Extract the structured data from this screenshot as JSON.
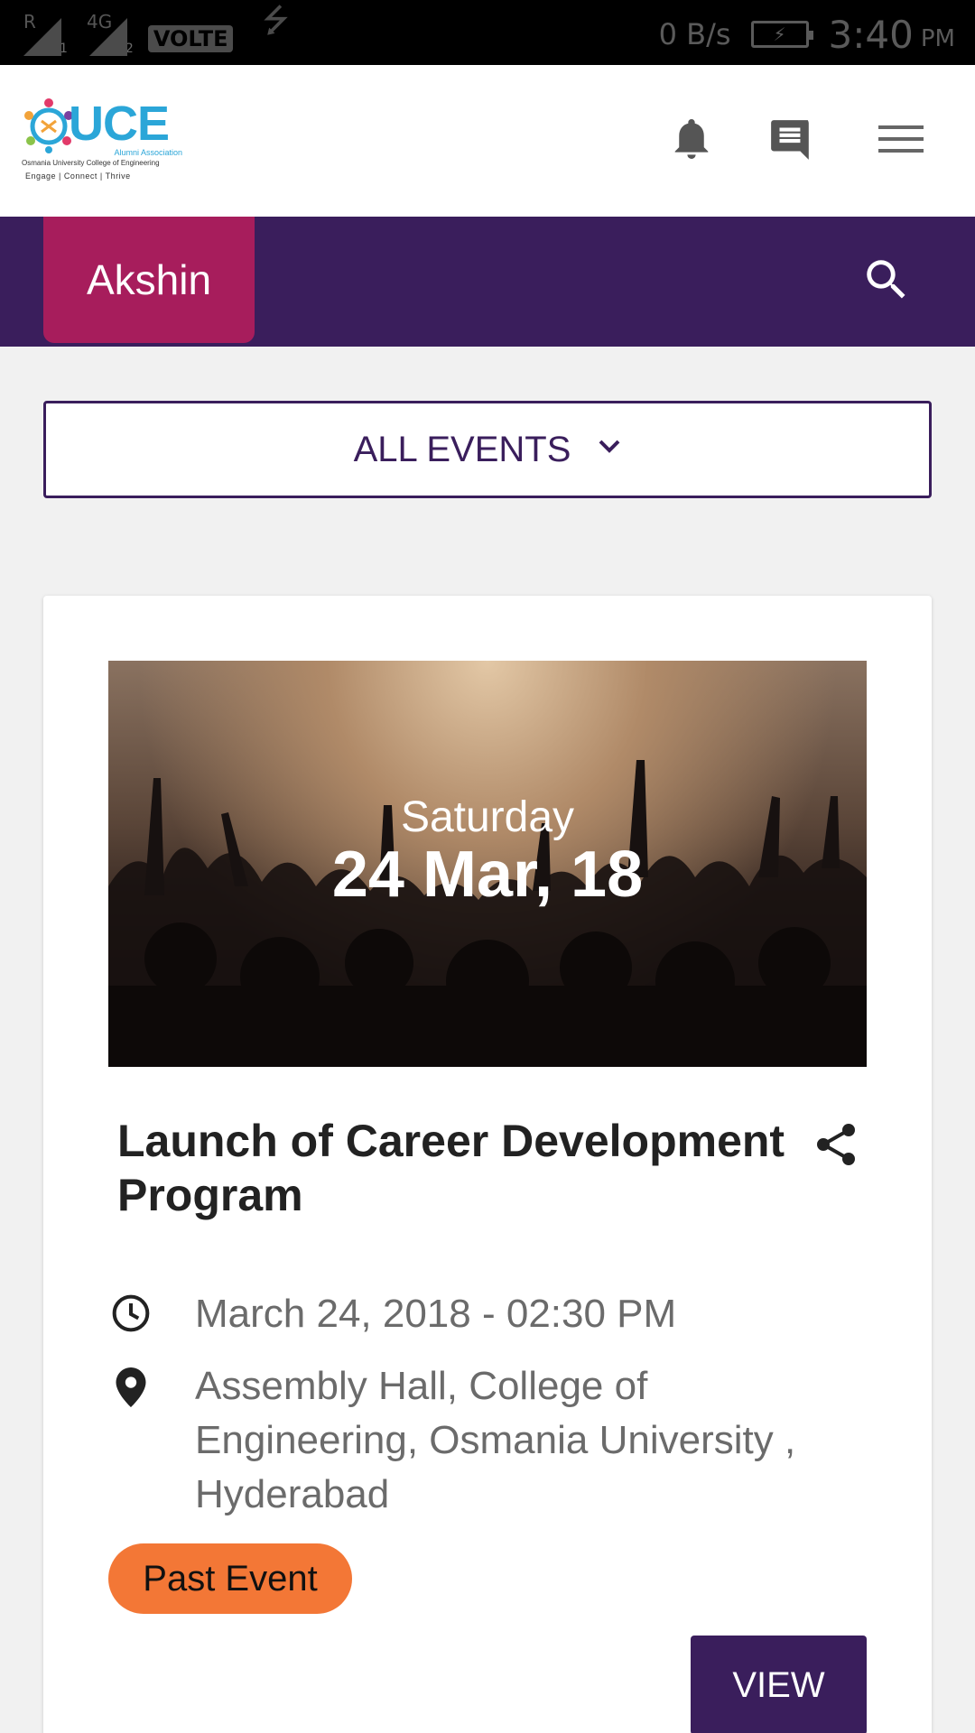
{
  "status_bar": {
    "carrier_left": "R",
    "sim1_sub": "1",
    "network_type": "4G",
    "sim2_sub": "2",
    "volte_label": "VOLTE",
    "data_speed": "0 B/s",
    "time": "3:40",
    "ampm": "PM",
    "icons": [
      "signal-icon",
      "signal-icon",
      "usb-icon",
      "battery-charging-icon"
    ]
  },
  "header": {
    "logo": {
      "name": "UCE",
      "subtitle": "Alumni Association",
      "org": "Osmania University College of Engineering",
      "tagline": "Engage  |  Connect  |  Thrive"
    },
    "icons": [
      "bell-icon",
      "chat-icon",
      "menu-icon"
    ]
  },
  "nav": {
    "user_tab_label": "Akshin",
    "search_icon": "search-icon",
    "colors": {
      "bar": "#3a1e5c",
      "tab": "#a71d5c"
    }
  },
  "filter": {
    "selected": "ALL EVENTS",
    "icon": "chevron-down-icon"
  },
  "event": {
    "day": "Saturday",
    "date": "24 Mar, 18",
    "title": "Launch of Career Development Program",
    "datetime": "March 24, 2018 - 02:30 PM",
    "location": "Assembly Hall, College of Engineering, Osmania University , Hyderabad",
    "status_badge": "Past Event",
    "view_label": "VIEW",
    "icons": [
      "share-icon",
      "clock-icon",
      "location-pin-icon"
    ],
    "colors": {
      "badge": "#f37736",
      "button": "#3a1e5c"
    }
  }
}
